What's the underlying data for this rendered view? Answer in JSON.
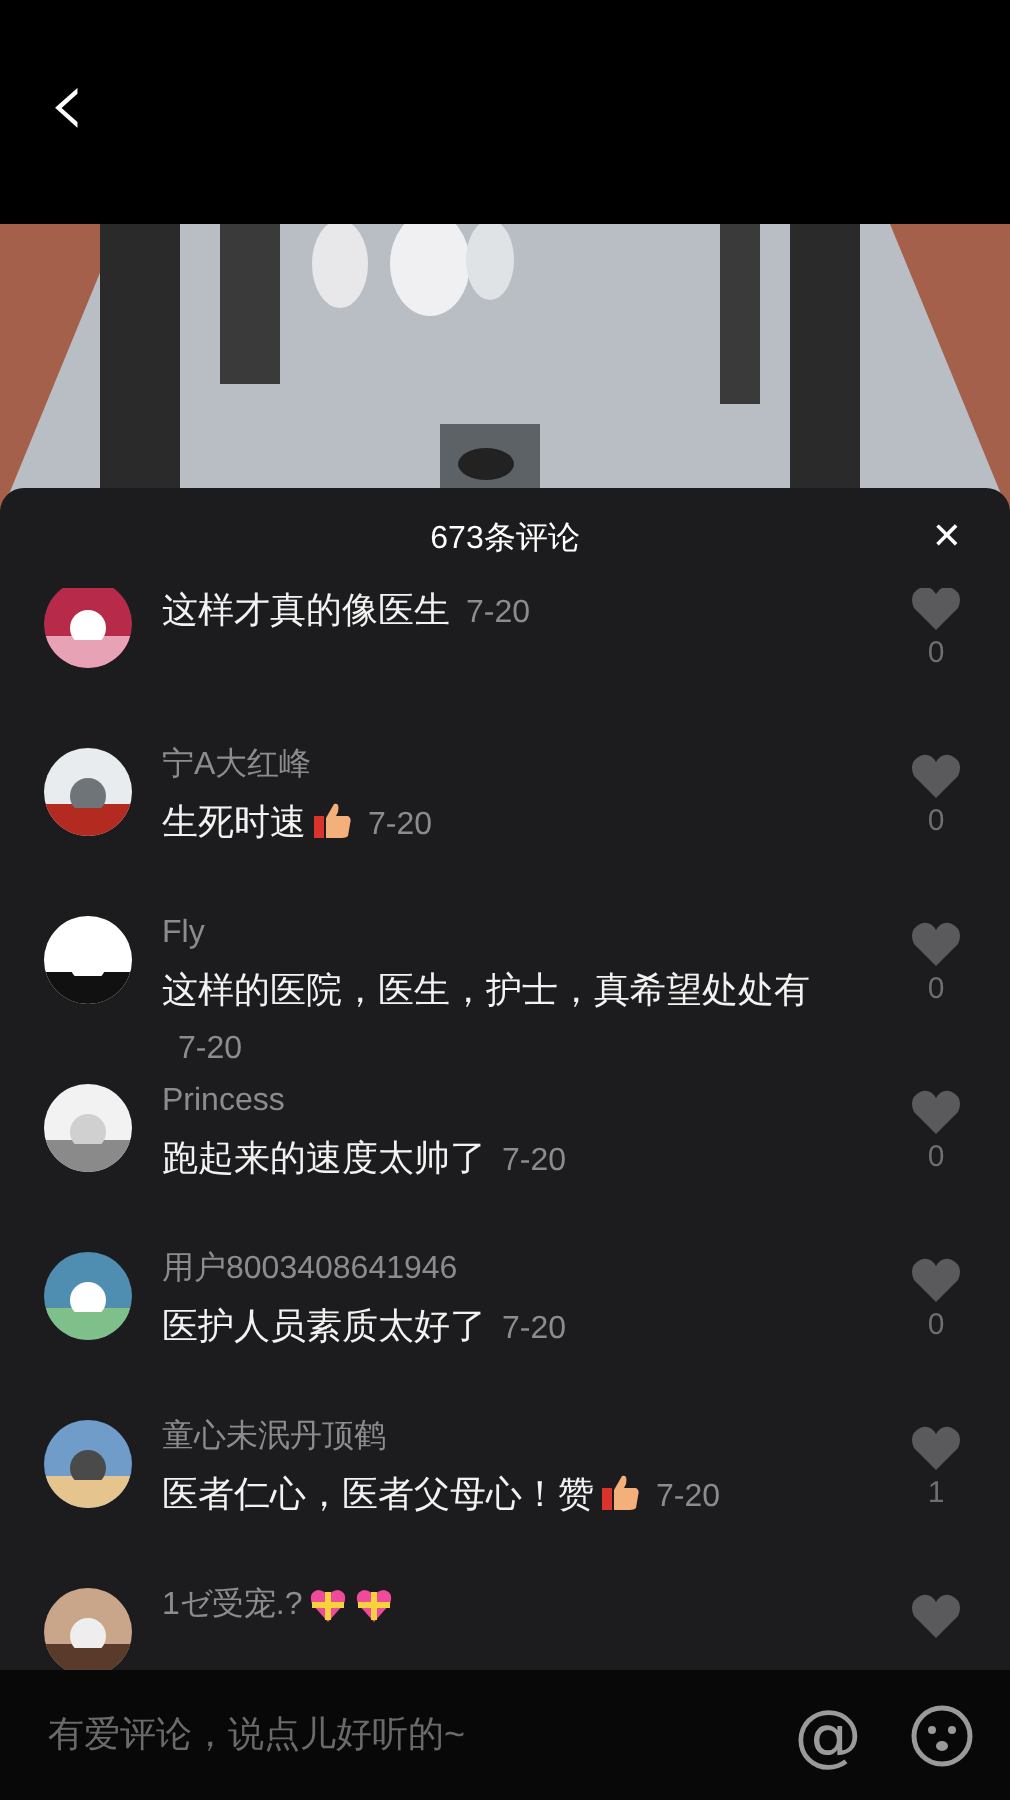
{
  "header": {
    "back": "‹"
  },
  "sheet": {
    "title": "673条评论",
    "close": "✕"
  },
  "comments": [
    {
      "text": "这样才真的像医生",
      "date": "7-20",
      "likes": "0",
      "thumb": false
    },
    {
      "name": "宁A大红峰",
      "text": "生死时速",
      "date": "7-20",
      "likes": "0",
      "thumb": true
    },
    {
      "name": "Fly",
      "text": "这样的医院，医生，护士，真希望处处有",
      "date": "7-20",
      "likes": "0",
      "thumb": false
    },
    {
      "name": "Princess",
      "text": "跑起来的速度太帅了",
      "date": "7-20",
      "likes": "0",
      "thumb": false
    },
    {
      "name": "用户8003408641946",
      "text": "医护人员素质太好了",
      "date": "7-20",
      "likes": "0",
      "thumb": false
    },
    {
      "name": "童心未泯丹顶鹤",
      "text": "医者仁心，医者父母心！赞",
      "date": "7-20",
      "likes": "1",
      "thumb": true
    },
    {
      "name": "1ゼ受宠.?",
      "name_badges": [
        {
          "kind": "gift_heart"
        },
        {
          "kind": "gift_heart"
        }
      ]
    }
  ],
  "input": {
    "placeholder": "有爱评论，说点儿好听的~",
    "mention": "@"
  }
}
